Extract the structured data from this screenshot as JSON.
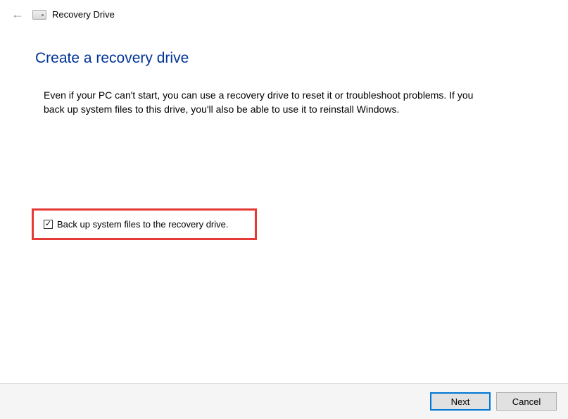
{
  "titlebar": {
    "window_title": "Recovery Drive"
  },
  "page": {
    "heading": "Create a recovery drive",
    "description": "Even if your PC can't start, you can use a recovery drive to reset it or troubleshoot problems. If you back up system files to this drive, you'll also be able to use it to reinstall Windows."
  },
  "checkbox": {
    "checked": true,
    "label": "Back up system files to the recovery drive."
  },
  "footer": {
    "next_label": "Next",
    "cancel_label": "Cancel"
  }
}
